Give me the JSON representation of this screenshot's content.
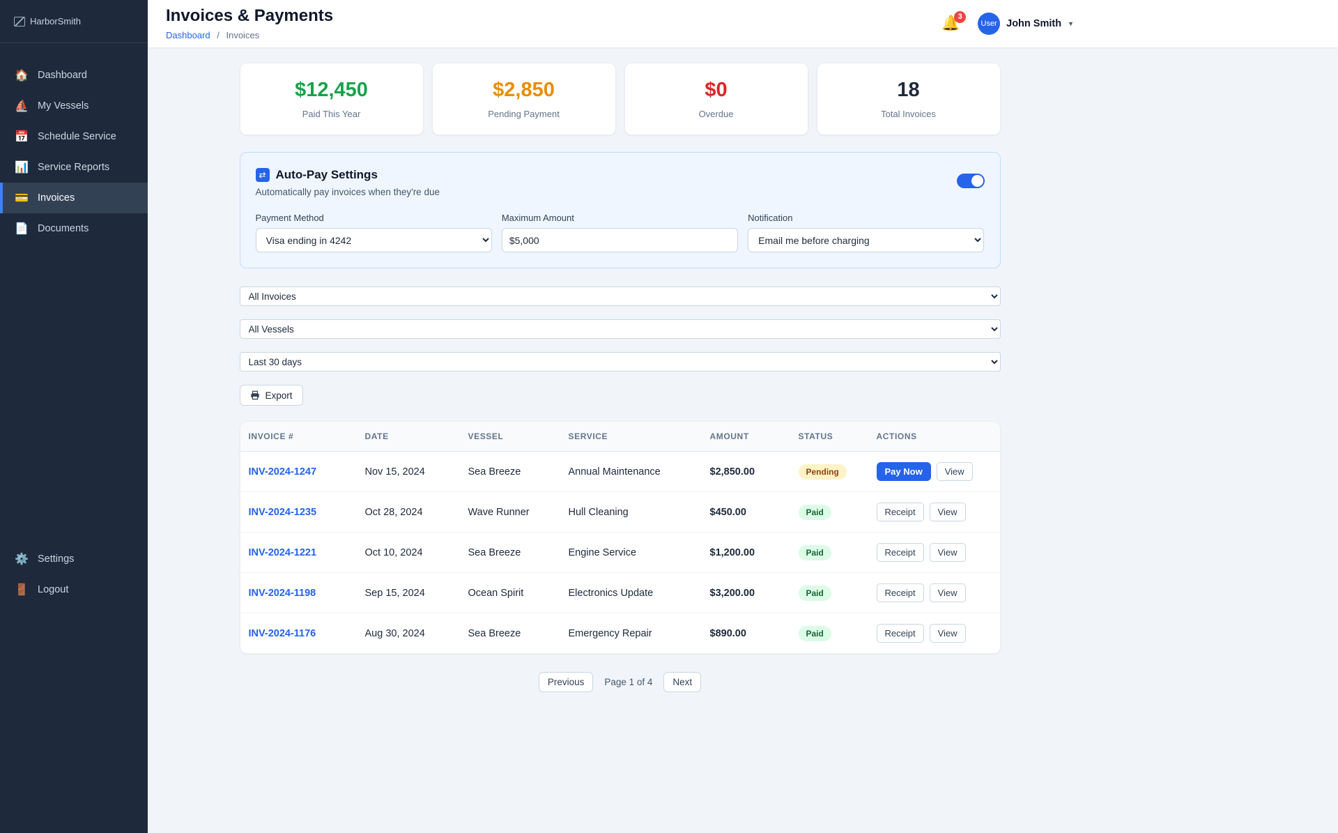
{
  "app_name": "HarborSmith",
  "sidebar": {
    "logo_alt": "HarborSmith",
    "items": [
      {
        "icon": "🏠",
        "label": "Dashboard"
      },
      {
        "icon": "⛵",
        "label": "My Vessels"
      },
      {
        "icon": "📅",
        "label": "Schedule Service"
      },
      {
        "icon": "📊",
        "label": "Service Reports"
      },
      {
        "icon": "💳",
        "label": "Invoices",
        "active": true
      },
      {
        "icon": "📄",
        "label": "Documents"
      }
    ],
    "footer_items": [
      {
        "icon": "⚙️",
        "label": "Settings"
      },
      {
        "icon": "🚪",
        "label": "Logout"
      }
    ]
  },
  "header": {
    "title": "Invoices & Payments",
    "breadcrumb": {
      "parent": "Dashboard",
      "separator": "/",
      "current": "Invoices"
    },
    "notifications": {
      "bell": "🔔",
      "badge": "3"
    },
    "user": {
      "avatar_alt": "User",
      "name": "John Smith",
      "caret": "▼"
    }
  },
  "stats": [
    {
      "value": "$12,450",
      "label": "Paid This Year",
      "color": "#16a34a"
    },
    {
      "value": "$2,850",
      "label": "Pending Payment",
      "color": "#ea8c00"
    },
    {
      "value": "$0",
      "label": "Overdue",
      "color": "#dc2626"
    },
    {
      "value": "18",
      "label": "Total Invoices",
      "color": "#1e293b"
    }
  ],
  "autopay": {
    "icon": "⇄",
    "title": "Auto-Pay Settings",
    "subtitle": "Automatically pay invoices when they're due",
    "enabled": true,
    "payment_method": {
      "label": "Payment Method",
      "value": "Visa ending in 4242"
    },
    "maximum_amount": {
      "label": "Maximum Amount",
      "value": "$5,000"
    },
    "notification": {
      "label": "Notification",
      "value": "Email me before charging"
    }
  },
  "filters": {
    "status": "All Invoices",
    "vessel": "All Vessels",
    "date_range": "Last 30 days"
  },
  "export": {
    "label": "Export"
  },
  "invoice_table": {
    "columns": [
      "INVOICE #",
      "DATE",
      "VESSEL",
      "SERVICE",
      "AMOUNT",
      "STATUS",
      "ACTIONS"
    ],
    "status_colors": {
      "pending_bg": "#fef3c7",
      "pending_text": "#92400e",
      "paid_bg": "#dcfce7",
      "paid_text": "#166534"
    },
    "rows": [
      {
        "invoice": "INV-2024-1247",
        "date": "Nov 15, 2024",
        "vessel": "Sea Breeze",
        "service": "Annual Maintenance",
        "amount": "$2,850.00",
        "status": "Pending",
        "actions": [
          "Pay Now",
          "View"
        ]
      },
      {
        "invoice": "INV-2024-1235",
        "date": "Oct 28, 2024",
        "vessel": "Wave Runner",
        "service": "Hull Cleaning",
        "amount": "$450.00",
        "status": "Paid",
        "actions": [
          "Receipt",
          "View"
        ]
      },
      {
        "invoice": "INV-2024-1221",
        "date": "Oct 10, 2024",
        "vessel": "Sea Breeze",
        "service": "Engine Service",
        "amount": "$1,200.00",
        "status": "Paid",
        "actions": [
          "Receipt",
          "View"
        ]
      },
      {
        "invoice": "INV-2024-1198",
        "date": "Sep 15, 2024",
        "vessel": "Ocean Spirit",
        "service": "Electronics Update",
        "amount": "$3,200.00",
        "status": "Paid",
        "actions": [
          "Receipt",
          "View"
        ]
      },
      {
        "invoice": "INV-2024-1176",
        "date": "Aug 30, 2024",
        "vessel": "Sea Breeze",
        "service": "Emergency Repair",
        "amount": "$890.00",
        "status": "Paid",
        "actions": [
          "Receipt",
          "View"
        ]
      }
    ]
  },
  "pagination": {
    "previous": "Previous",
    "status": "Page 1 of 4",
    "next": "Next"
  }
}
